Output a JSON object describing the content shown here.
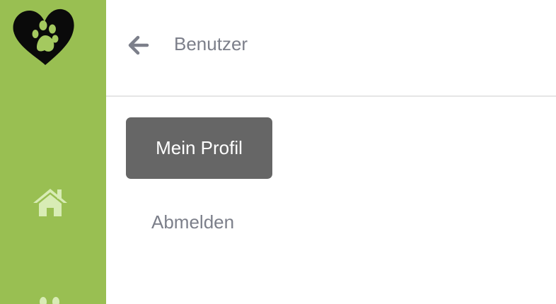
{
  "app": {
    "logo_icon": "heart-paw-logo"
  },
  "sidebar": {
    "background_color": "#99bf52",
    "icon_color": "#d8ecb5",
    "items": [
      {
        "icon": "home-icon"
      },
      {
        "icon": "paw-icon"
      }
    ]
  },
  "header": {
    "back_icon": "arrow-left-icon",
    "title": "Benutzer"
  },
  "menu": {
    "items": [
      {
        "label": "Mein Profil",
        "active": true
      },
      {
        "label": "Abmelden",
        "active": false
      }
    ],
    "active_background": "#666666",
    "text_color": "#7c7f8a"
  }
}
